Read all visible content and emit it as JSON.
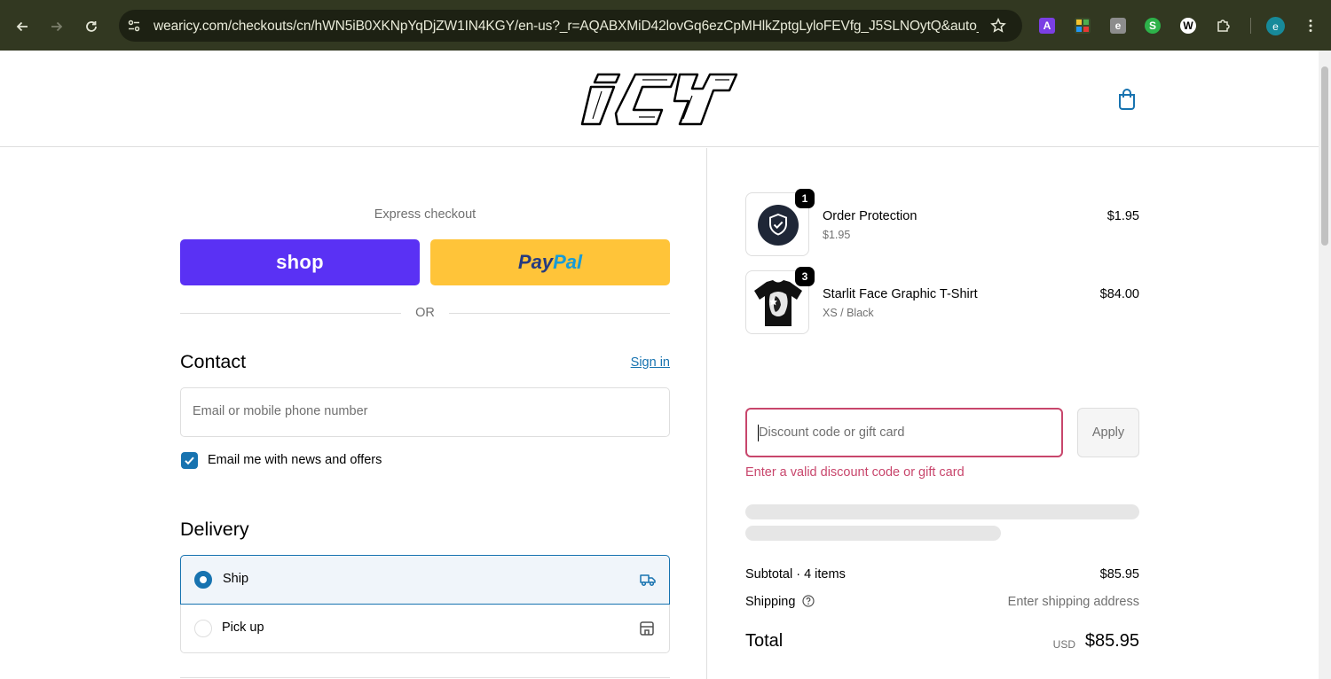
{
  "browser": {
    "url": "wearicy.com/checkouts/cn/hWN5iB0XKNpYqDjZW1IN4KGY/en-us?_r=AQABXMiD42lovGq6ezCpMHlkZptgLyloFEVfg_J5SLNOytQ&auto_...",
    "extensions": [
      {
        "name": "extension-a-icon",
        "glyph": "A",
        "color": "#7b3fe4"
      },
      {
        "name": "extension-grid-icon",
        "glyph": "",
        "color": "#4a8f3a"
      },
      {
        "name": "extension-e-icon",
        "glyph": "e",
        "color": "#8d8d8d"
      },
      {
        "name": "extension-s-icon",
        "glyph": "S",
        "color": "#2db24a"
      },
      {
        "name": "extension-w-icon",
        "glyph": "W",
        "color": "#ffffff"
      }
    ],
    "profile_initial": "e"
  },
  "store": {
    "logo_text": "ICY"
  },
  "express": {
    "label": "Express checkout",
    "shop_label": "shop",
    "paypal_part1": "Pay",
    "paypal_part2": "Pal",
    "or_label": "OR"
  },
  "contact": {
    "heading": "Contact",
    "signin_label": "Sign in",
    "email_placeholder": "Email or mobile phone number",
    "newsletter_label": "Email me with news and offers",
    "newsletter_checked": true
  },
  "delivery": {
    "heading": "Delivery",
    "options": [
      {
        "label": "Ship",
        "selected": true
      },
      {
        "label": "Pick up",
        "selected": false
      }
    ]
  },
  "summary": {
    "items": [
      {
        "name": "Order Protection",
        "variant": "$1.95",
        "price": "$1.95",
        "qty": "1"
      },
      {
        "name": "Starlit Face Graphic T-Shirt",
        "variant": "XS / Black",
        "price": "$84.00",
        "qty": "3"
      }
    ],
    "discount_placeholder": "Discount code or gift card",
    "apply_label": "Apply",
    "discount_error": "Enter a valid discount code or gift card",
    "subtotal_label": "Subtotal · 4 items",
    "subtotal_value": "$85.95",
    "shipping_label": "Shipping",
    "shipping_value": "Enter shipping address",
    "total_label": "Total",
    "total_currency": "USD",
    "total_value": "$85.95"
  },
  "colors": {
    "accent": "#1773b0",
    "shop_purple": "#5a31f4",
    "paypal_yellow": "#ffc439",
    "error": "#c8466c"
  }
}
